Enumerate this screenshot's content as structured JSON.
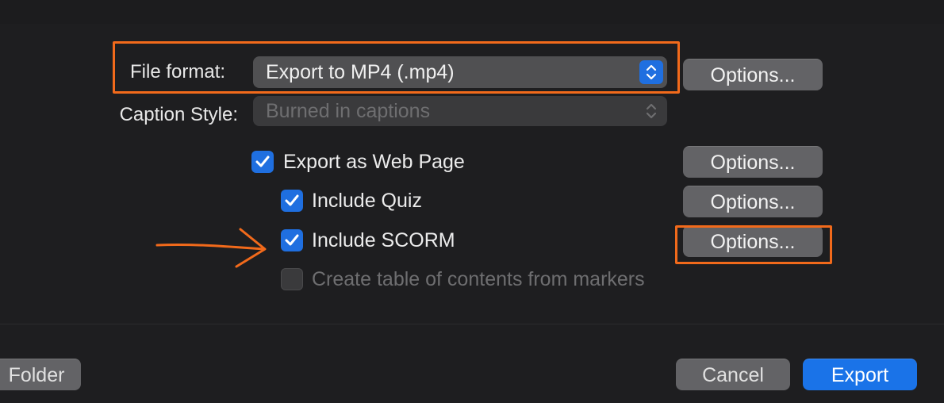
{
  "format": {
    "label": "File format:",
    "value": "Export to MP4 (.mp4)",
    "options_label": "Options..."
  },
  "caption": {
    "label": "Caption Style:",
    "value": "Burned in captions"
  },
  "web_page": {
    "label": "Export as Web Page",
    "checked": true,
    "options_label": "Options..."
  },
  "quiz": {
    "label": "Include Quiz",
    "checked": true,
    "options_label": "Options..."
  },
  "scorm": {
    "label": "Include SCORM",
    "checked": true,
    "options_label": "Options..."
  },
  "toc": {
    "label": "Create table of contents from markers",
    "checked": false
  },
  "footer": {
    "folder_label": "Folder",
    "cancel_label": "Cancel",
    "export_label": "Export"
  },
  "colors": {
    "accent": "#1a73e8",
    "highlight": "#f26a1b",
    "background": "#1e1e20"
  },
  "icons": {
    "stepper": "up-down-chevron-icon",
    "check": "checkmark-icon",
    "annotation": "arrow-right-icon"
  }
}
